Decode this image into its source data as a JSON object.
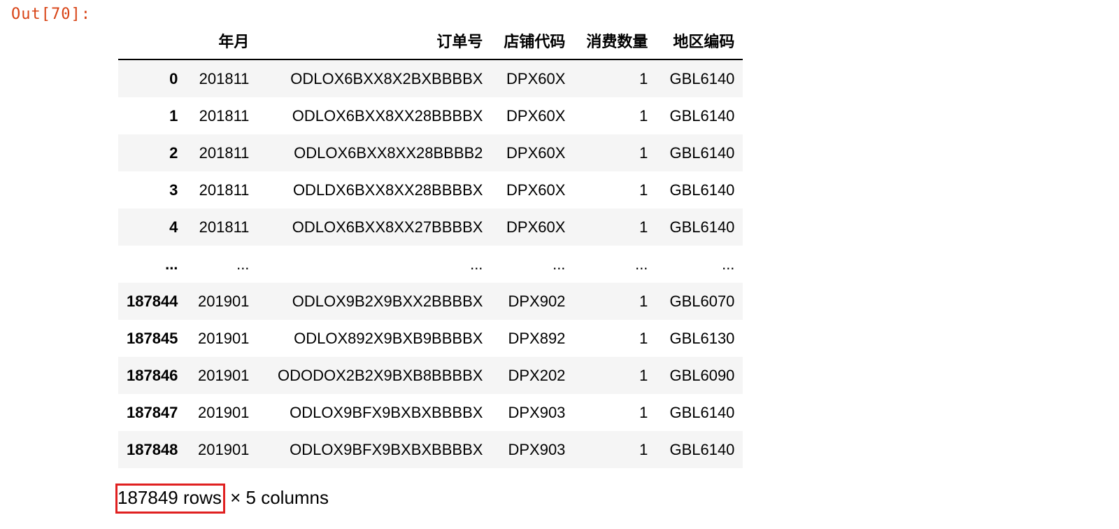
{
  "cell": {
    "out_prompt": "Out[70]:"
  },
  "table": {
    "columns": [
      "年月",
      "订单号",
      "店铺代码",
      "消费数量",
      "地区编码"
    ],
    "rows": [
      [
        "0",
        "201811",
        "ODLOX6BXX8X2BXBBBBX",
        "DPX60X",
        "1",
        "GBL6140"
      ],
      [
        "1",
        "201811",
        "ODLOX6BXX8XX28BBBBX",
        "DPX60X",
        "1",
        "GBL6140"
      ],
      [
        "2",
        "201811",
        "ODLOX6BXX8XX28BBBB2",
        "DPX60X",
        "1",
        "GBL6140"
      ],
      [
        "3",
        "201811",
        "ODLDX6BXX8XX28BBBBX",
        "DPX60X",
        "1",
        "GBL6140"
      ],
      [
        "4",
        "201811",
        "ODLOX6BXX8XX27BBBBX",
        "DPX60X",
        "1",
        "GBL6140"
      ],
      [
        "...",
        "...",
        "...",
        "...",
        "...",
        "..."
      ],
      [
        "187844",
        "201901",
        "ODLOX9B2X9BXX2BBBBX",
        "DPX902",
        "1",
        "GBL6070"
      ],
      [
        "187845",
        "201901",
        "ODLOX892X9BXB9BBBBX",
        "DPX892",
        "1",
        "GBL6130"
      ],
      [
        "187846",
        "201901",
        "ODODOX2B2X9BXB8BBBBX",
        "DPX202",
        "1",
        "GBL6090"
      ],
      [
        "187847",
        "201901",
        "ODLOX9BFX9BXBXBBBBX",
        "DPX903",
        "1",
        "GBL6140"
      ],
      [
        "187848",
        "201901",
        "ODLOX9BFX9BXBXBBBBX",
        "DPX903",
        "1",
        "GBL6140"
      ]
    ]
  },
  "dimensions": {
    "rows_text": "187849 rows",
    "columns_text": " × 5 columns"
  },
  "colors": {
    "prompt": "#d84315",
    "highlight_box": "#e02020",
    "stripe": "#f5f5f5"
  }
}
